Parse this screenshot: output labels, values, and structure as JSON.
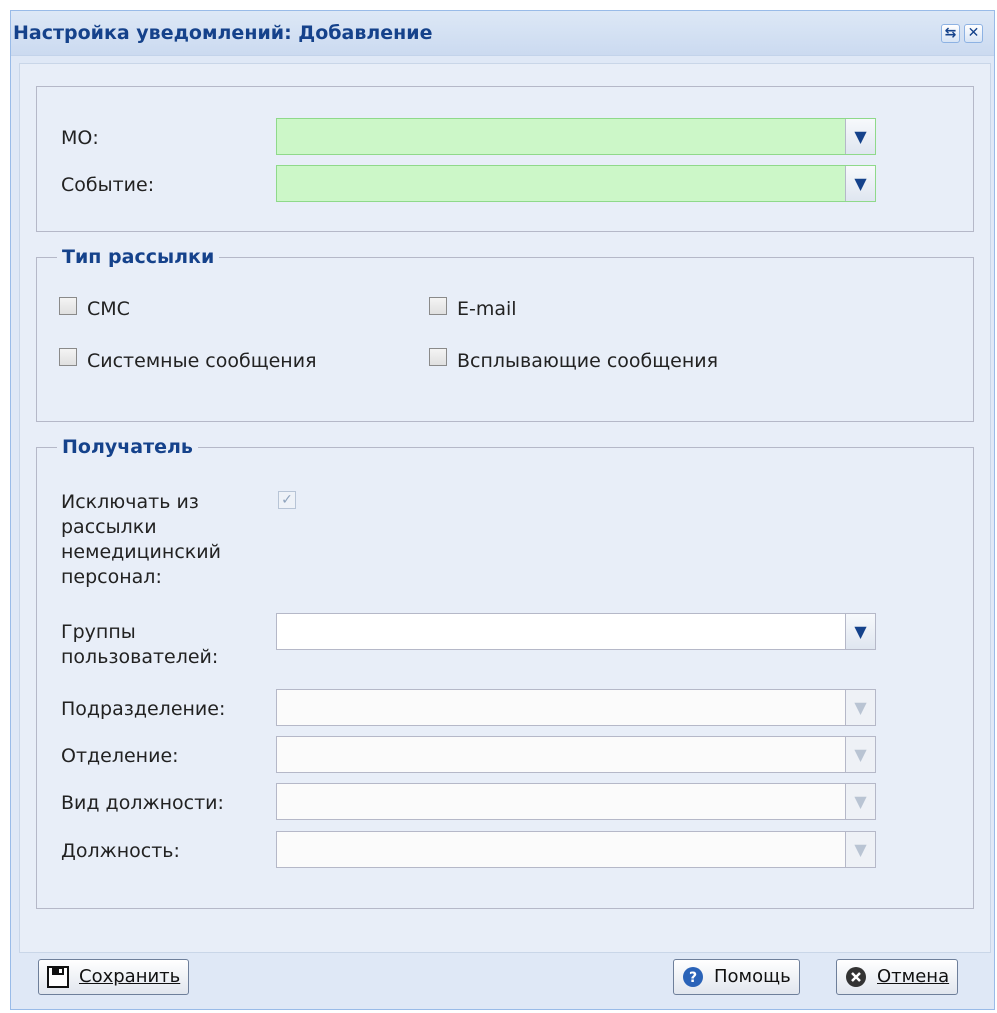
{
  "window": {
    "title": "Настройка уведомлений: Добавление",
    "tools": {
      "refresh_icon": "refresh-icon",
      "close_icon": "close-icon"
    }
  },
  "main_form": {
    "mo_label": "МО:",
    "mo_value": "",
    "event_label": "Событие:",
    "event_value": ""
  },
  "mailing_type": {
    "legend": "Тип рассылки",
    "sms_label": "СМС",
    "email_label": "E-mail",
    "system_label": "Системные сообщения",
    "popup_label": "Всплывающие сообщения",
    "sms_checked": false,
    "email_checked": false,
    "system_checked": false,
    "popup_checked": false
  },
  "recipient": {
    "legend": "Получатель",
    "exclude_label_lines": [
      "Исключать из",
      "рассылки",
      "немедицинский",
      "персонал:"
    ],
    "exclude_checked": true,
    "groups_label_lines": [
      "Группы",
      "пользователей:"
    ],
    "subdivision_label": "Подразделение:",
    "department_label": "Отделение:",
    "position_type_label": "Вид должности:",
    "position_label": "Должность:"
  },
  "footer": {
    "save_label": "Сохранить",
    "help_label": "Помощь",
    "cancel_label": "Отмена"
  },
  "colors": {
    "required_field": "#ccf7c8",
    "title_text": "#15428b",
    "window_bg": "#dfe8f6"
  }
}
